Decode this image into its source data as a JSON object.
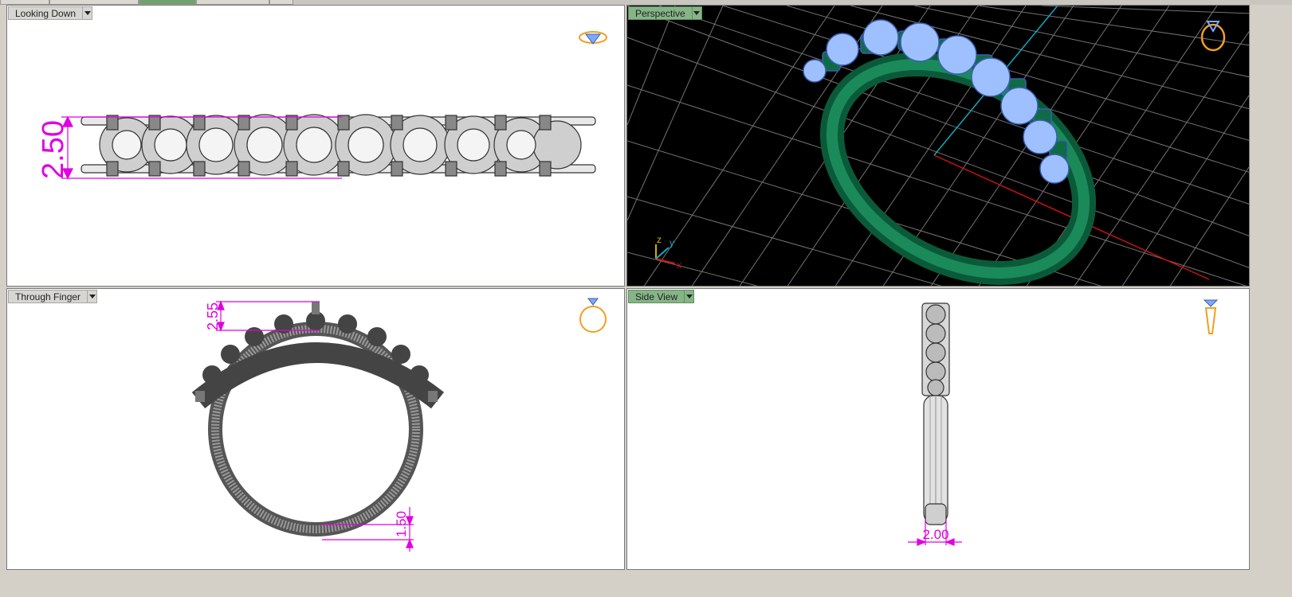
{
  "viewports": {
    "top_left": {
      "label": "Looking Down",
      "dimension": "2.50"
    },
    "top_right": {
      "label": "Perspective",
      "axes": {
        "z": "z",
        "y": "y",
        "x": "x"
      }
    },
    "bottom_left": {
      "label": "Through Finger",
      "dimension_top": "2.55",
      "dimension_bottom": "1.50"
    },
    "bottom_right": {
      "label": "Side View",
      "dimension": "2.00"
    }
  },
  "colors": {
    "dimension": "#e000e0",
    "ring_green": "#0f6b45",
    "gem_blue": "#9ec0ff",
    "icon_orange": "#f0a020",
    "active_label": "#86b486",
    "grid": "#9a9a9a",
    "axis_red": "#d01010",
    "axis_cyan": "#10a8c0"
  },
  "icons": {
    "top_left": "ring-top-icon",
    "top_right": "ring-perspective-icon",
    "bottom_left": "ring-front-icon",
    "bottom_right": "ring-side-icon"
  }
}
